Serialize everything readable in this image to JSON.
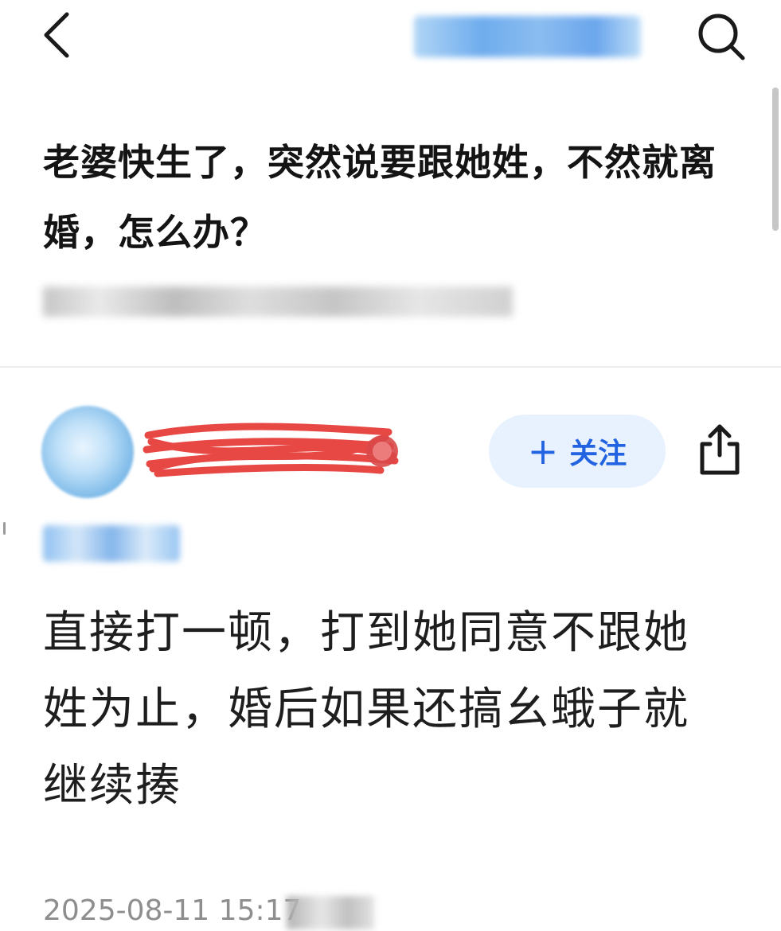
{
  "header": {
    "back_icon": "chevron-left-icon",
    "search_icon": "search-icon"
  },
  "question": {
    "title": "老婆快生了，突然说要跟她姓，不然就离婚，怎么办？"
  },
  "answer": {
    "follow_label": "关注",
    "follow_plus": "+",
    "share_icon": "share-icon",
    "body": "直接打一顿，打到她同意不跟她姓为止，婚后如果还搞幺蛾子就继续揍",
    "timestamp": "2025-08-11 15:17"
  },
  "colors": {
    "accent": "#2163e0",
    "follow_bg": "#e8f1fe",
    "scribble": "#e53935"
  }
}
